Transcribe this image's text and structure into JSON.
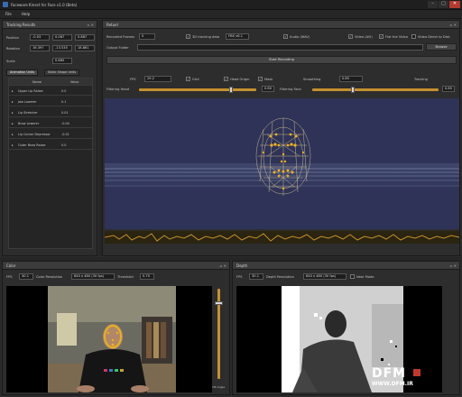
{
  "window": {
    "title": "Faceware Kinect for Face v1.0 (Beta)"
  },
  "menu": [
    "File",
    "Help"
  ],
  "tracking_results": {
    "title": "Tracking Results",
    "position_label": "Position",
    "position": [
      "-0.03",
      "0.087",
      "0.887"
    ],
    "rotation_label": "Rotation",
    "rotation": [
      "16.397",
      "-13.535",
      "18.861"
    ],
    "scale_label": "Scale",
    "scale": "0.885",
    "tabs": [
      "Animation Units",
      "Static Shape Units"
    ],
    "columns": [
      "Name",
      "Value"
    ],
    "rows": [
      {
        "name": "Upper Lip Raiser",
        "value": "0.0"
      },
      {
        "name": "Jaw Lowerer",
        "value": "0.1"
      },
      {
        "name": "Lip Stretcher",
        "value": "0.01"
      },
      {
        "name": "Brow Lowerer",
        "value": "-0.04"
      },
      {
        "name": "Lip Corner Depressor",
        "value": "-0.01"
      },
      {
        "name": "Outer Brow Raiser",
        "value": "0.0"
      }
    ]
  },
  "replay": {
    "title": "Retuel",
    "recorded_frames_label": "Recorded Frames",
    "recorded_frames": "0",
    "save_tracking_label": "3D tracking data",
    "save_tracking_value": "FBX v6.1",
    "audio_label": "Audio (WAV)",
    "video_label": "Video (AVI)",
    "flat_video_label": "Flat the Video",
    "video_direct_label": "Video Direct to Disk",
    "output_folder_label": "Output Folder",
    "browse_label": "Browse",
    "start_recording_label": "Start Recording",
    "fps_label": "FPS",
    "fps_value": "29.2",
    "grid_label": "Grid",
    "head_origin_label": "Head Origin",
    "mask_label": "Mask",
    "smoothing_label": "Smoothing",
    "smoothing_value": "0.85",
    "tracking_label": "Tracking",
    "filtering_head_label": "Filtering Head",
    "filtering_head_value": "0.80",
    "filtering_face_label": "Filtering Face",
    "filtering_face_value": "0.85"
  },
  "color_panel": {
    "title": "Color",
    "fps_label": "FPS",
    "fps_value": "30.1",
    "resolution_label": "Color Resolution",
    "resolution_value": "640 x 480 (30 fps)",
    "threshold_label": "Threshold",
    "threshold_value": "0.70",
    "tilt_label": "Tilt Angle"
  },
  "depth_panel": {
    "title": "Depth",
    "fps_label": "FPS",
    "fps_value": "30.1",
    "resolution_label": "Depth Resolution",
    "resolution_value": "640 x 480 (30 fps)",
    "near_mode_label": "Near Mode"
  },
  "watermark": {
    "logo_text": "DFM",
    "url_text": "WWW.DFM.IR"
  },
  "colors": {
    "accent": "#c4902e",
    "viewport_bg": "#2f3358",
    "mesh_points": "#f2b01e"
  }
}
